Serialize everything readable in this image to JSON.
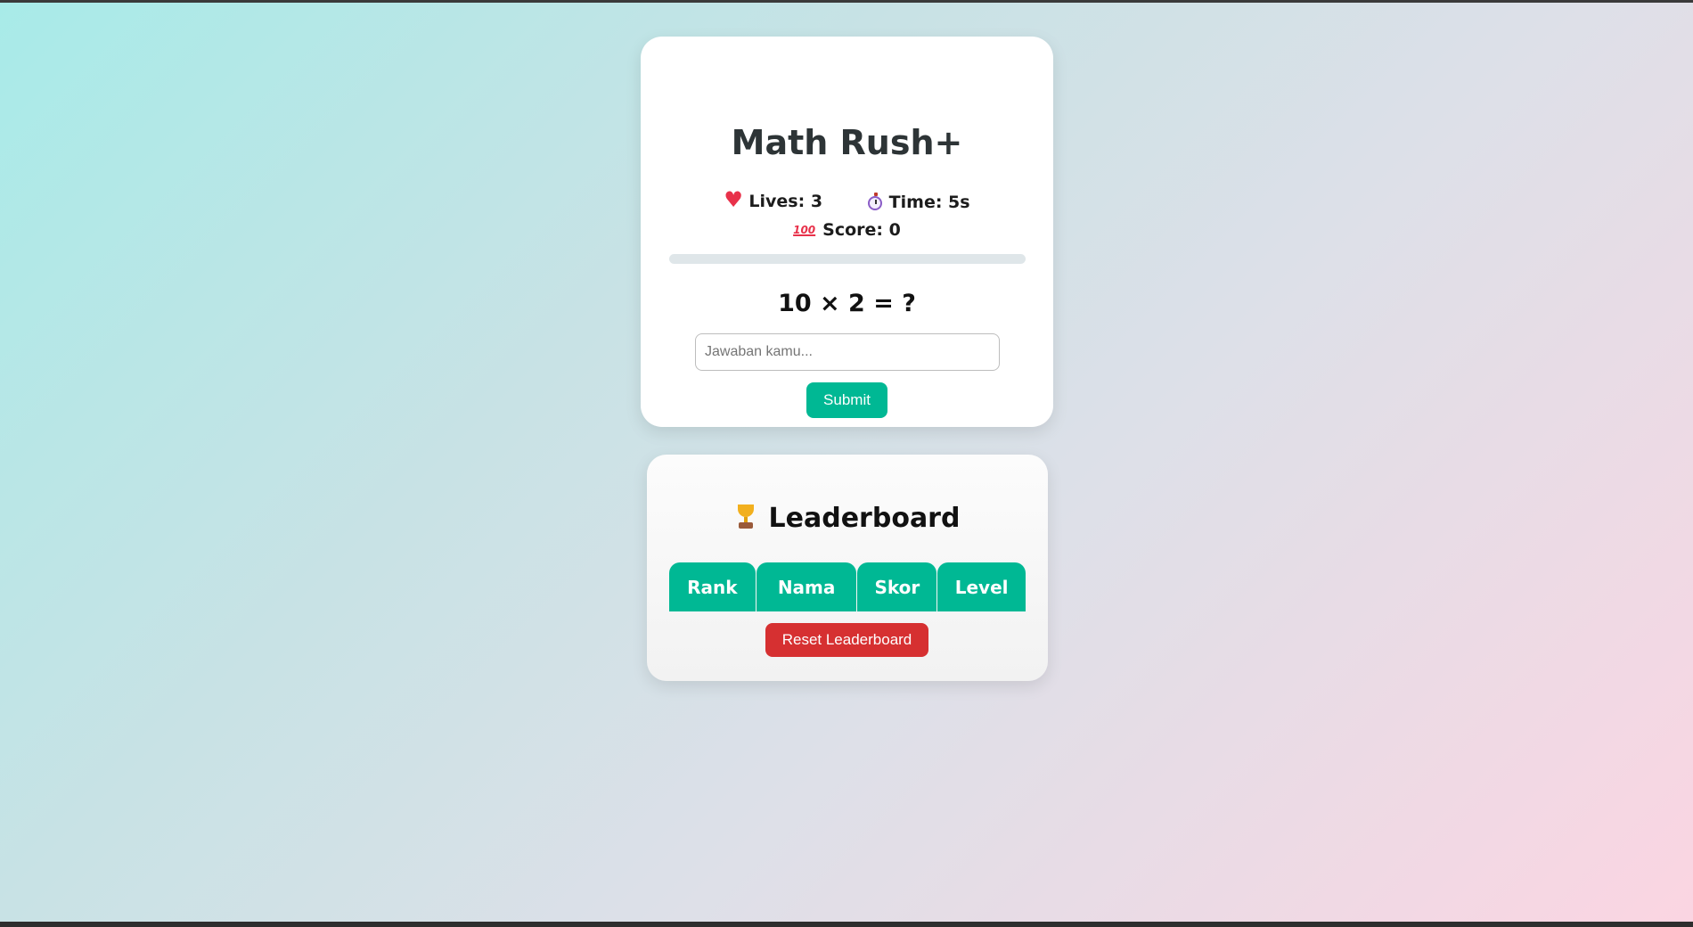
{
  "game": {
    "title": "Math Rush+",
    "lives_label": "Lives: 3",
    "time_label": "Time: 5s",
    "score_label": "Score: 0",
    "timer_progress": 0,
    "question": "10 × 2 = ?",
    "answer_placeholder": "Jawaban kamu...",
    "answer_value": "",
    "submit_label": "Submit",
    "icons": [
      "heart-icon",
      "stopwatch-icon",
      "hundred-points-icon"
    ]
  },
  "leaderboard": {
    "title": "Leaderboard",
    "icon": "trophy-icon",
    "columns": [
      "Rank",
      "Nama",
      "Skor",
      "Level"
    ],
    "rows": [],
    "reset_label": "Reset Leaderboard"
  },
  "colors": {
    "accent": "#00b894",
    "danger": "#d63031",
    "title_text": "#2d3436"
  }
}
